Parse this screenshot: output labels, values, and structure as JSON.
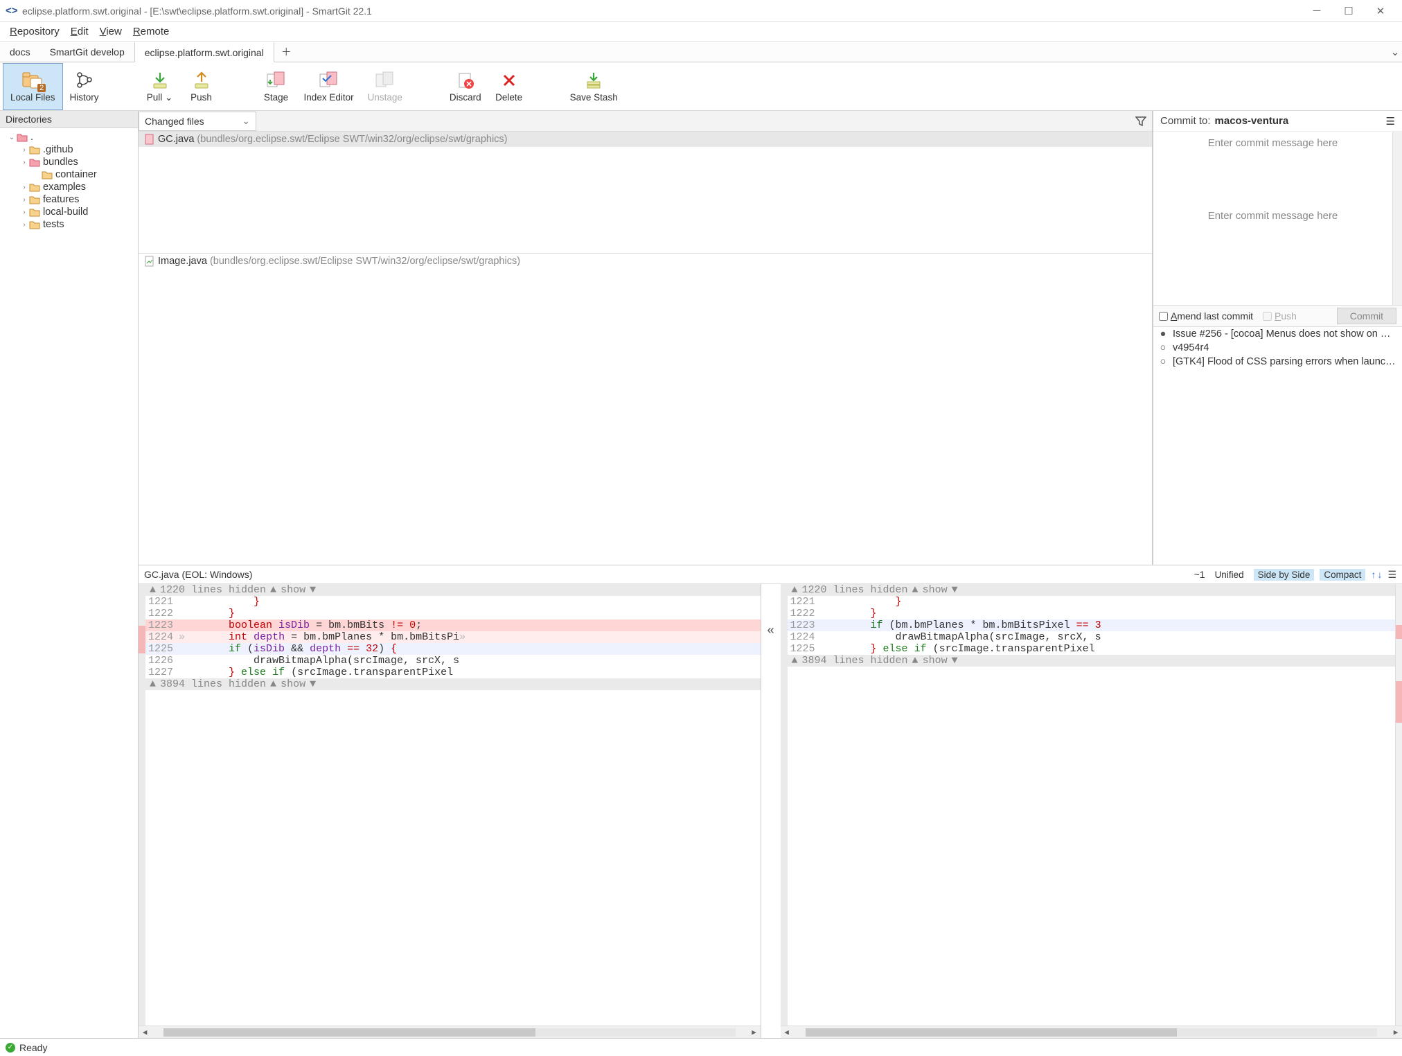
{
  "title": "eclipse.platform.swt.original - [E:\\swt\\eclipse.platform.swt.original] - SmartGit 22.1",
  "menu": [
    "Repository",
    "Edit",
    "View",
    "Remote"
  ],
  "tabs": [
    {
      "label": "docs"
    },
    {
      "label": "SmartGit develop"
    },
    {
      "label": "eclipse.platform.swt.original",
      "active": true
    }
  ],
  "toolbar": {
    "localFiles": {
      "label": "Local Files",
      "badge": "2"
    },
    "history": {
      "label": "History"
    },
    "pull": {
      "label": "Pull"
    },
    "push": {
      "label": "Push"
    },
    "stage": {
      "label": "Stage"
    },
    "indexEditor": {
      "label": "Index Editor"
    },
    "unstage": {
      "label": "Unstage"
    },
    "discard": {
      "label": "Discard"
    },
    "delete": {
      "label": "Delete"
    },
    "saveStash": {
      "label": "Save Stash"
    }
  },
  "dirHeader": "Directories",
  "dirs": [
    {
      "name": ".",
      "open": true,
      "depth": 0,
      "kind": "root"
    },
    {
      "name": ".github",
      "depth": 1,
      "kind": "folder",
      "expandable": true
    },
    {
      "name": "bundles",
      "depth": 1,
      "kind": "bundles",
      "expandable": true
    },
    {
      "name": "container",
      "depth": 2,
      "kind": "folder"
    },
    {
      "name": "examples",
      "depth": 1,
      "kind": "folder",
      "expandable": true
    },
    {
      "name": "features",
      "depth": 1,
      "kind": "folder",
      "expandable": true
    },
    {
      "name": "local-build",
      "depth": 1,
      "kind": "folder",
      "expandable": true
    },
    {
      "name": "tests",
      "depth": 1,
      "kind": "folder",
      "expandable": true
    }
  ],
  "changedLabel": "Changed files",
  "files": [
    {
      "name": "GC.java",
      "path": "(bundles/org.eclipse.swt/Eclipse SWT/win32/org/eclipse/swt/graphics)",
      "selected": true,
      "modified": true
    },
    {
      "name": "Image.java",
      "path": "(bundles/org.eclipse.swt/Eclipse SWT/win32/org/eclipse/swt/graphics)"
    }
  ],
  "commit": {
    "toLabel": "Commit to:",
    "branch": "macos-ventura",
    "placeholder": "Enter commit message here",
    "amend": "Amend last commit",
    "push": "Push",
    "commitBtn": "Commit"
  },
  "log": [
    "Issue #256 - [cocoa] Menus does not show on …",
    "v4954r4",
    "[GTK4] Flood of CSS parsing errors when launc…"
  ],
  "diff": {
    "fileLabel": "GC.java (EOL: Windows)",
    "countLabel": "~1",
    "modes": {
      "unified": "Unified",
      "sbs": "Side by Side",
      "compact": "Compact"
    },
    "hiddenTop": "1220 lines hidden",
    "show": "show",
    "hiddenBottom": "3894 lines hidden",
    "left": [
      {
        "n": "1221",
        "t": "            }"
      },
      {
        "n": "1222",
        "t": "        }"
      },
      {
        "n": "1223",
        "t": "        boolean isDib = bm.bmBits != 0;",
        "cls": "del-strong"
      },
      {
        "n": "1224",
        "t": "»       int depth = bm.bmPlanes * bm.bmBitsPi»",
        "cls": "del"
      },
      {
        "n": "1225",
        "t": "        if (isDib && depth == 32) {",
        "cls": "mod"
      },
      {
        "n": "1226",
        "t": "            drawBitmapAlpha(srcImage, srcX, s"
      },
      {
        "n": "1227",
        "t": "        } else if (srcImage.transparentPixel"
      }
    ],
    "right": [
      {
        "n": "1221",
        "t": "            }"
      },
      {
        "n": "1222",
        "t": "        }"
      },
      {
        "n": "1223",
        "t": "        if (bm.bmPlanes * bm.bmBitsPixel == 3",
        "cls": "mod"
      },
      {
        "n": "1224",
        "t": "            drawBitmapAlpha(srcImage, srcX, s"
      },
      {
        "n": "1225",
        "t": "        } else if (srcImage.transparentPixel"
      }
    ]
  },
  "status": "Ready"
}
